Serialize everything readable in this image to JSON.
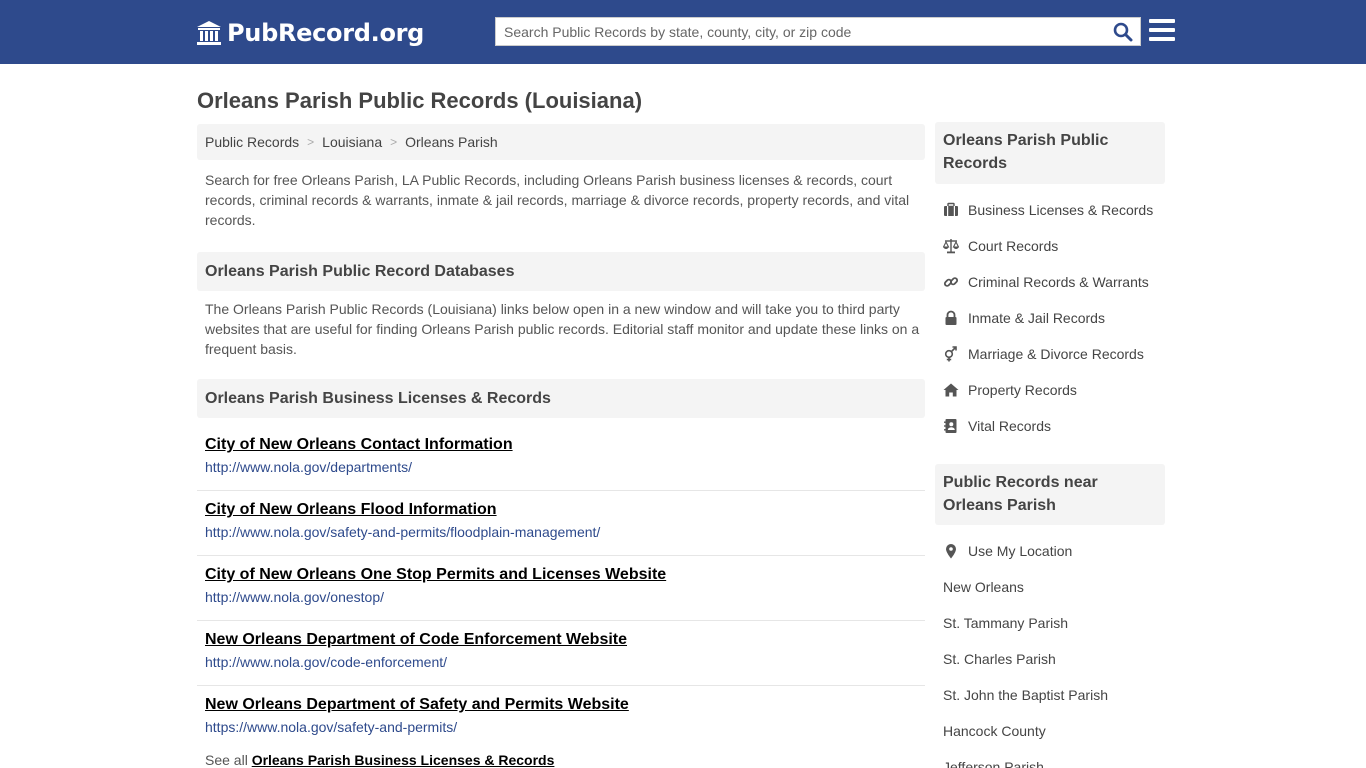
{
  "header": {
    "logo_text": "PubRecord.org",
    "search_placeholder": "Search Public Records by state, county, city, or zip code"
  },
  "main": {
    "title": "Orleans Parish Public Records (Louisiana)",
    "breadcrumb": [
      "Public Records",
      "Louisiana",
      "Orleans Parish"
    ],
    "intro": "Search for free Orleans Parish, LA Public Records, including Orleans Parish business licenses & records, court records, criminal records & warrants, inmate & jail records, marriage & divorce records, property records, and vital records.",
    "databases_heading": "Orleans Parish Public Record Databases",
    "databases_text": "The Orleans Parish Public Records (Louisiana) links below open in a new window and will take you to third party websites that are useful for finding Orleans Parish public records. Editorial staff monitor and update these links on a frequent basis.",
    "business_heading": "Orleans Parish Business Licenses & Records",
    "records": [
      {
        "title": "City of New Orleans Contact Information",
        "url": "http://www.nola.gov/departments/"
      },
      {
        "title": "City of New Orleans Flood Information",
        "url": "http://www.nola.gov/safety-and-permits/floodplain-management/"
      },
      {
        "title": "City of New Orleans One Stop Permits and Licenses Website",
        "url": "http://www.nola.gov/onestop/"
      },
      {
        "title": "New Orleans Department of Code Enforcement Website",
        "url": "http://www.nola.gov/code-enforcement/"
      },
      {
        "title": "New Orleans Department of Safety and Permits Website",
        "url": "https://www.nola.gov/safety-and-permits/"
      }
    ],
    "see_all_prefix": "See all",
    "see_all_link": "Orleans Parish Business Licenses & Records"
  },
  "sidebar": {
    "records_heading": "Orleans Parish Public Records",
    "record_links": [
      {
        "label": "Business Licenses & Records",
        "icon": "briefcase-icon"
      },
      {
        "label": "Court Records",
        "icon": "scales-icon"
      },
      {
        "label": "Criminal Records & Warrants",
        "icon": "link-icon"
      },
      {
        "label": "Inmate & Jail Records",
        "icon": "lock-icon"
      },
      {
        "label": "Marriage & Divorce Records",
        "icon": "gender-icon"
      },
      {
        "label": "Property Records",
        "icon": "home-icon"
      },
      {
        "label": "Vital Records",
        "icon": "address-book-icon"
      }
    ],
    "near_heading": "Public Records near Orleans Parish",
    "use_location": "Use My Location",
    "near_links": [
      "New Orleans",
      "St. Tammany Parish",
      "St. Charles Parish",
      "St. John the Baptist Parish",
      "Hancock County",
      "Jefferson Parish"
    ]
  },
  "colors": {
    "header_bg": "#2e4a8c",
    "link_blue": "#2e4a8c",
    "panel_bg": "#f4f4f4"
  }
}
